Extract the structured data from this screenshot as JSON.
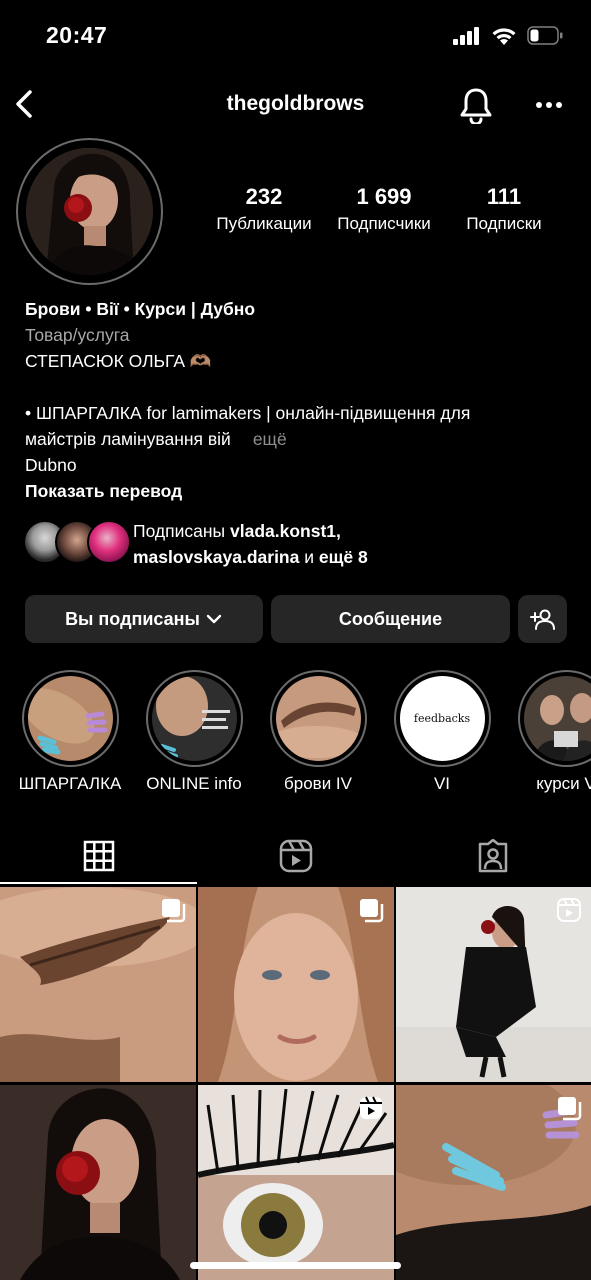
{
  "status_bar": {
    "time": "20:47"
  },
  "header": {
    "username": "thegoldbrows"
  },
  "stats": [
    {
      "value": "232",
      "label": "Публикации"
    },
    {
      "value": "1 699",
      "label": "Подписчики"
    },
    {
      "value": "111",
      "label": "Подписки"
    }
  ],
  "bio": {
    "name": "Брови • Вії • Курси | Дубно",
    "category": "Товар/услуга",
    "line1": "СТЕПАСЮК ОЛЬГА 🫶🏽",
    "line2": "• ШПАРГАЛКА for lamimakers | онлайн-підвищення для",
    "line3": "майстрів ламінування вій",
    "more": "ещё",
    "location": "Dubno",
    "translate": "Показать перевод"
  },
  "followers": {
    "prefix": "Подписаны",
    "user1": "vlada.konst1,",
    "user2": "maslovskaya.darina",
    "middle": "и",
    "suffix": "ещё 8"
  },
  "actions": {
    "following_label": "Вы подписаны",
    "message_label": "Сообщение"
  },
  "highlights": [
    {
      "label": "ШПАРГАЛКА"
    },
    {
      "label": "ONLINE info"
    },
    {
      "label": "брови IV"
    },
    {
      "label": "VI",
      "cover_text": "feedbacks"
    },
    {
      "label": "курси V"
    }
  ],
  "colors": {
    "background": "#000000",
    "button_bg": "#262626",
    "secondary_text": "#a8a8a8",
    "ring": "#6b6b6b"
  }
}
